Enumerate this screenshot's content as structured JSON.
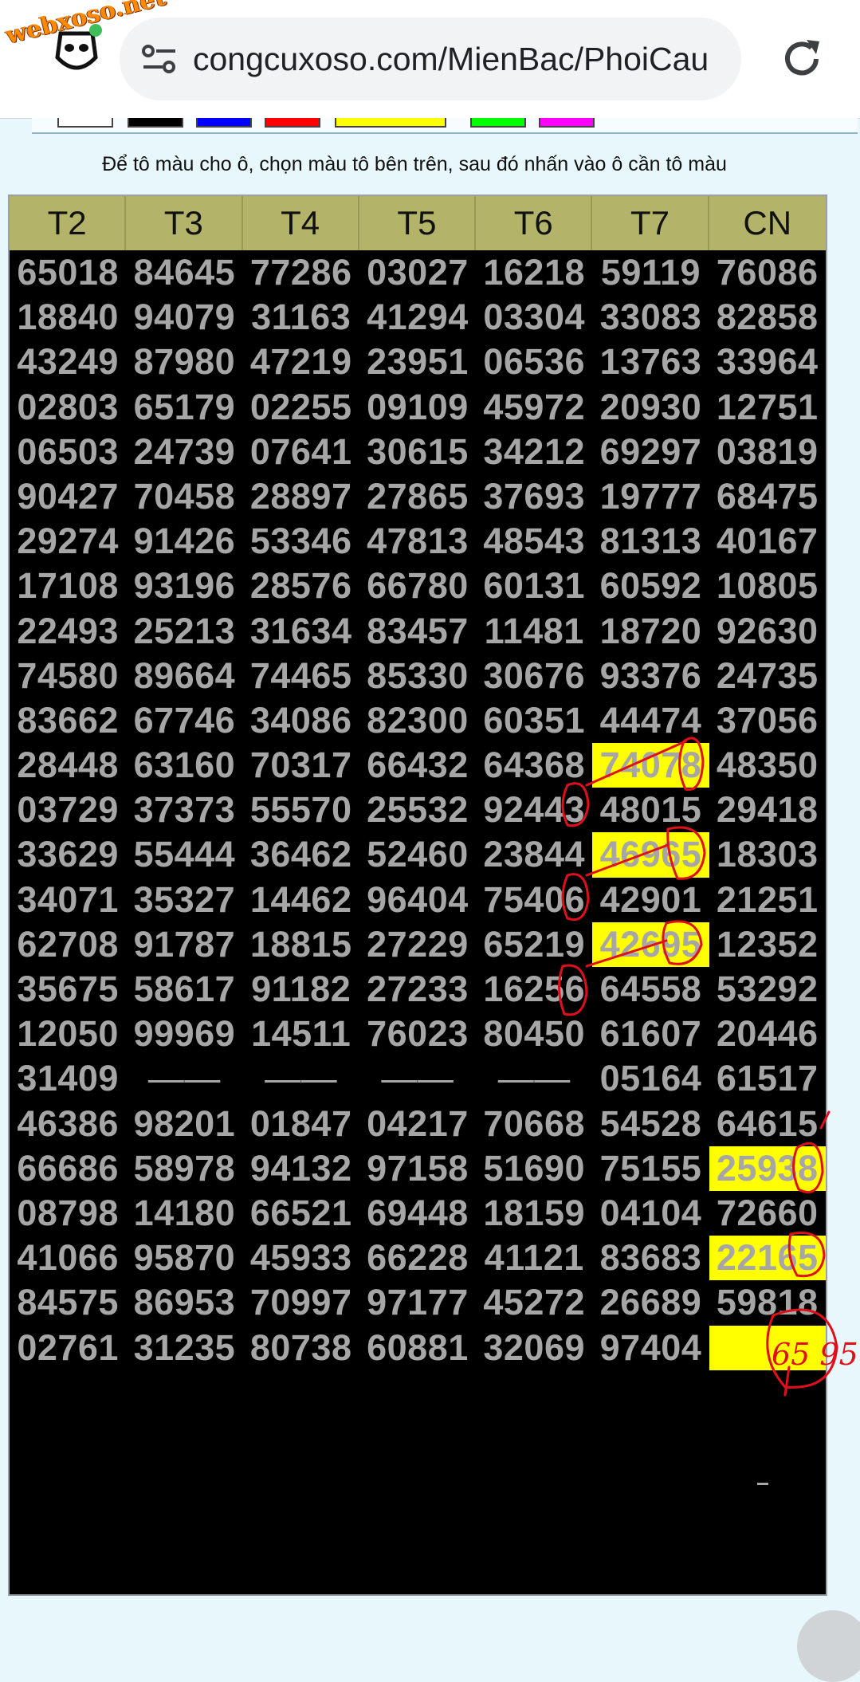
{
  "browser": {
    "logo_text": "webxoso.net",
    "url": "congcuxoso.com/MienBac/PhoiCau"
  },
  "palette": {
    "colors": [
      "#ffffff",
      "#000000",
      "#0000ff",
      "#ff0000",
      "#ffff00",
      "#00ff00",
      "#ff00ff"
    ]
  },
  "hint": "Để tô màu cho ô, chọn màu tô bên trên, sau đó nhấn vào ô cần tô màu",
  "table": {
    "headers": [
      "T2",
      "T3",
      "T4",
      "T5",
      "T6",
      "T7",
      "CN"
    ],
    "rows": [
      [
        "65018",
        "84645",
        "77286",
        "03027",
        "16218",
        "59119",
        "76086"
      ],
      [
        "18840",
        "94079",
        "31163",
        "41294",
        "03304",
        "33083",
        "82858"
      ],
      [
        "43249",
        "87980",
        "47219",
        "23951",
        "06536",
        "13763",
        "33964"
      ],
      [
        "02803",
        "65179",
        "02255",
        "09109",
        "45972",
        "20930",
        "12751"
      ],
      [
        "06503",
        "24739",
        "07641",
        "30615",
        "34212",
        "69297",
        "03819"
      ],
      [
        "90427",
        "70458",
        "28897",
        "27865",
        "37693",
        "19777",
        "68475"
      ],
      [
        "29274",
        "91426",
        "53346",
        "47813",
        "48543",
        "81313",
        "40167"
      ],
      [
        "17108",
        "93196",
        "28576",
        "66780",
        "60131",
        "60592",
        "10805"
      ],
      [
        "22493",
        "25213",
        "31634",
        "83457",
        "11481",
        "18720",
        "92630"
      ],
      [
        "74580",
        "89664",
        "74465",
        "85330",
        "30676",
        "93376",
        "24735"
      ],
      [
        "83662",
        "67746",
        "34086",
        "82300",
        "60351",
        "44474",
        "37056"
      ],
      [
        "28448",
        "63160",
        "70317",
        "66432",
        "64368",
        "74078",
        "48350"
      ],
      [
        "03729",
        "37373",
        "55570",
        "25532",
        "92443",
        "48015",
        "29418"
      ],
      [
        "33629",
        "55444",
        "36462",
        "52460",
        "23844",
        "46965",
        "18303"
      ],
      [
        "34071",
        "35327",
        "14462",
        "96404",
        "75406",
        "42901",
        "21251"
      ],
      [
        "62708",
        "91787",
        "18815",
        "27229",
        "65219",
        "42695",
        "12352"
      ],
      [
        "35675",
        "58617",
        "91182",
        "27233",
        "16256",
        "64558",
        "53292"
      ],
      [
        "12050",
        "99969",
        "14511",
        "76023",
        "80450",
        "61607",
        "20446"
      ],
      [
        "31409",
        "——",
        "——",
        "——",
        "——",
        "05164",
        "61517"
      ],
      [
        "46386",
        "98201",
        "01847",
        "04217",
        "70668",
        "54528",
        "64615"
      ],
      [
        "66686",
        "58978",
        "94132",
        "97158",
        "51690",
        "75155",
        "25938"
      ],
      [
        "08798",
        "14180",
        "66521",
        "69448",
        "18159",
        "04104",
        "72660"
      ],
      [
        "41066",
        "95870",
        "45933",
        "66228",
        "41121",
        "83683",
        "22165"
      ],
      [
        "84575",
        "86953",
        "70997",
        "97177",
        "45272",
        "26689",
        "59818"
      ],
      [
        "02761",
        "31235",
        "80738",
        "60881",
        "32069",
        "97404",
        ""
      ]
    ],
    "highlighted": [
      [
        11,
        5
      ],
      [
        13,
        5
      ],
      [
        15,
        5
      ],
      [
        20,
        6
      ],
      [
        22,
        6
      ],
      [
        24,
        6
      ]
    ]
  },
  "annotation": {
    "handwritten": "65 95"
  },
  "colors": {
    "highlight": "#ffff00",
    "header_bg": "#b3b36a",
    "cell_text": "#a6a6a6",
    "ink": "#e0101a"
  }
}
